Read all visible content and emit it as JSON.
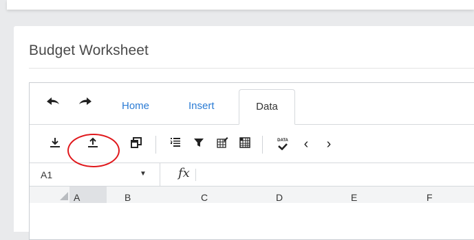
{
  "page": {
    "title": "Budget Worksheet"
  },
  "quick_access": {
    "undo_icon": "undo-icon",
    "redo_icon": "redo-icon"
  },
  "tabs": [
    {
      "label": "Home",
      "active": false
    },
    {
      "label": "Insert",
      "active": false
    },
    {
      "label": "Data",
      "active": true
    }
  ],
  "ribbon": {
    "buttons": [
      {
        "icon": "import-icon"
      },
      {
        "icon": "export-icon"
      },
      {
        "icon": "sheet-icon"
      },
      {
        "icon": "list-icon"
      },
      {
        "icon": "filter-icon"
      },
      {
        "icon": "edit-grid-icon"
      },
      {
        "icon": "table-grid-icon"
      },
      {
        "icon": "data-validation-icon",
        "text": "DATA"
      },
      {
        "icon": "chevron-left-icon",
        "text": "‹"
      },
      {
        "icon": "chevron-right-icon",
        "text": "›"
      }
    ],
    "highlight_color": "#e0171b"
  },
  "formula_bar": {
    "name_box": "A1",
    "fx_label": "fx",
    "formula_value": ""
  },
  "grid": {
    "columns": [
      "A",
      "B",
      "C",
      "D",
      "E",
      "F"
    ],
    "selected_column": "A"
  },
  "colors": {
    "accent": "#2a7bd4",
    "background": "#e9eaec",
    "highlight": "#e0171b"
  }
}
